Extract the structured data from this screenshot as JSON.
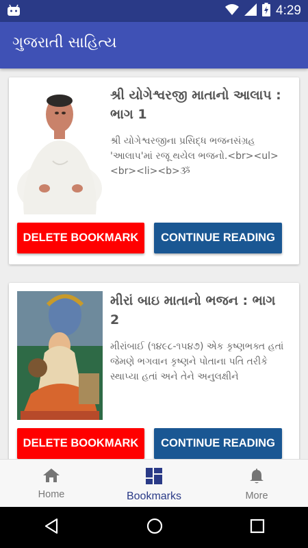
{
  "status_bar": {
    "time": "4:29"
  },
  "app_bar": {
    "title": "ગુજરાતી સાહિત્ય"
  },
  "cards": [
    {
      "title": "શ્રી યોગેશ્વરજી માતાનો આલાપ : ભાગ 1",
      "description": "શ્રી યોગેશ્વરજીના પ્રસિદ્ધ ભજનસંગ્રહ 'આલાપ'માં રજૂ થયેલ ભજનો.<br><ul><br><li><b>ૐ",
      "delete_label": "DELETE BOOKMARK",
      "continue_label": "CONTINUE READING"
    },
    {
      "title": "મીરાં બાઇ માતાનો ભજન : ભાગ 2",
      "description": "મીરાંબાઈ (૧૪૯૮-૧૫૪૭) એક કૃષ્ણભક્ત હતાં જેમણે ભગવાન કૃષ્ણને પોતાના પતિ તરીકે સ્થાપ્યા હતાં અને તેને અનુલક્ષીને",
      "delete_label": "DELETE BOOKMARK",
      "continue_label": "CONTINUE READING"
    }
  ],
  "bottom_nav": {
    "items": [
      {
        "label": "Home",
        "icon": "home-icon"
      },
      {
        "label": "Bookmarks",
        "icon": "dashboard-icon",
        "active": true
      },
      {
        "label": "More",
        "icon": "bell-icon"
      }
    ]
  },
  "colors": {
    "status_bar": "#2a3a87",
    "app_bar": "#3f51b5",
    "delete": "#ff0000",
    "continue": "#1a5793",
    "active_nav": "#2a3a87"
  }
}
